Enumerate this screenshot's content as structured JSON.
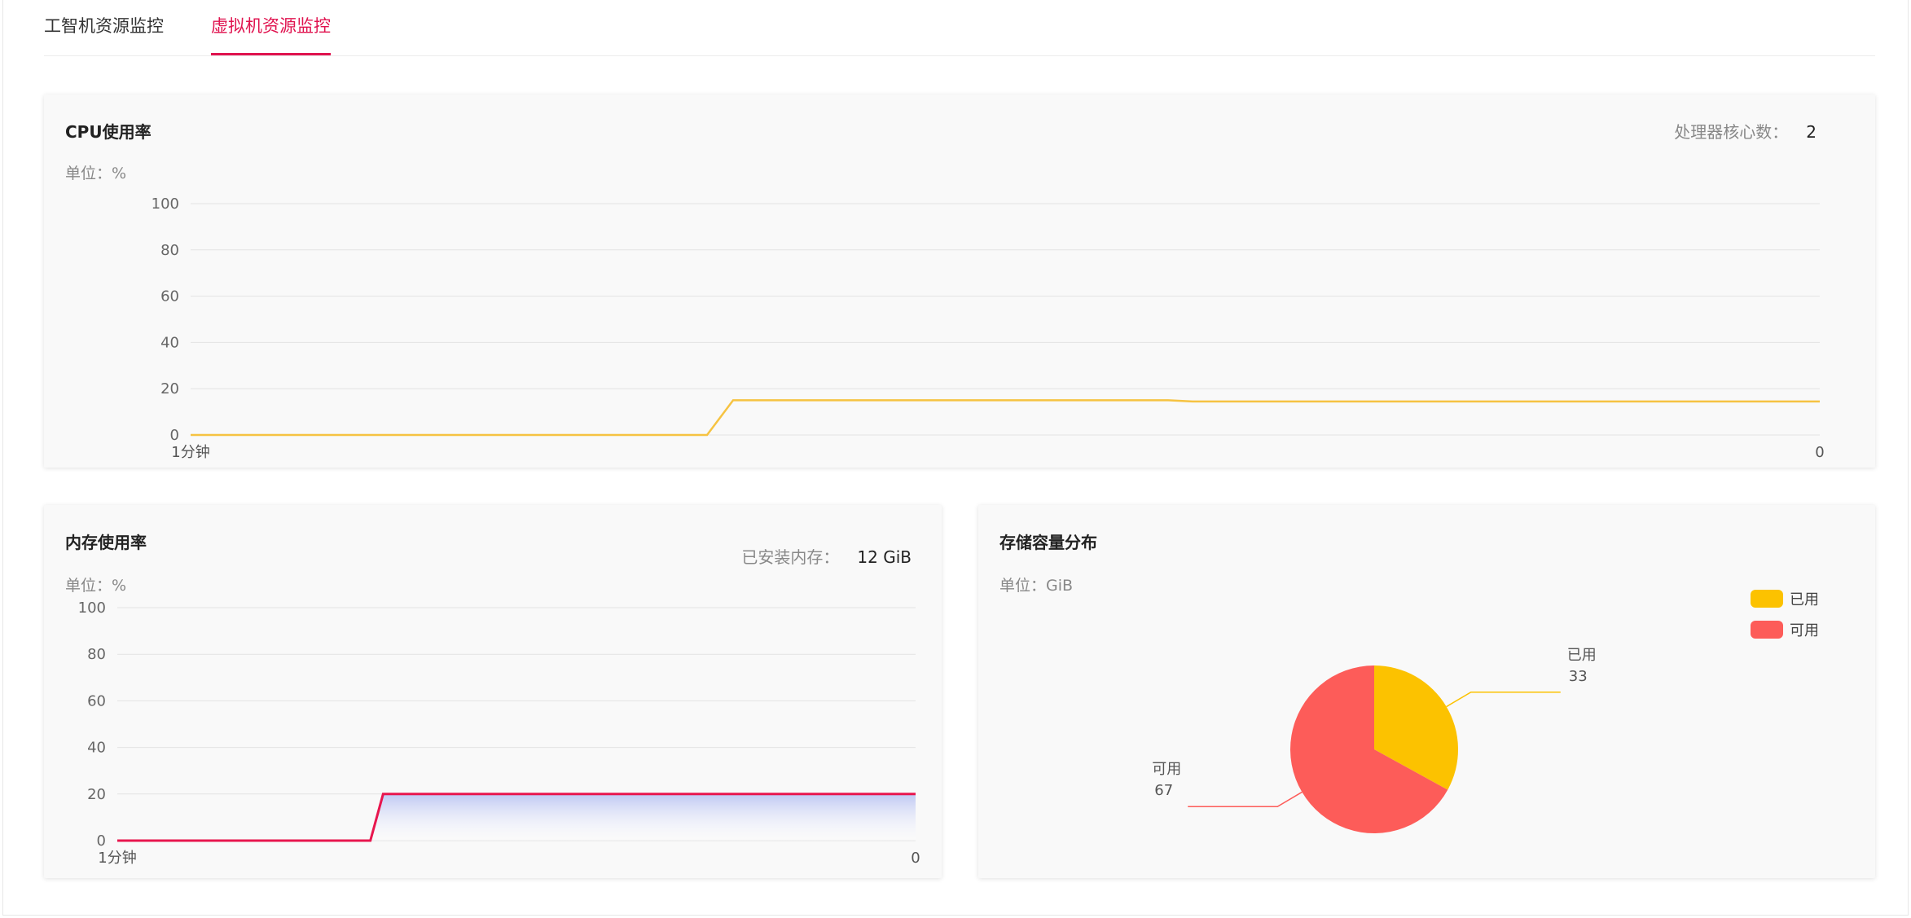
{
  "tabs": [
    {
      "label": "工智机资源监控",
      "active": false
    },
    {
      "label": "虚拟机资源监控",
      "active": true
    }
  ],
  "colors": {
    "accent": "#e0134f",
    "cpu_line": "#f6c342",
    "mem_line": "#e8164e",
    "used": "#fcc200",
    "available": "#fd5c59"
  },
  "cpu": {
    "title": "CPU使用率",
    "unit_label": "单位：%",
    "cores_label": "处理器核心数：",
    "cores_value": "2"
  },
  "memory": {
    "title": "内存使用率",
    "unit_label": "单位：%",
    "installed_label": "已安装内存：",
    "installed_value": "12 GiB"
  },
  "storage": {
    "title": "存储容量分布",
    "unit_label": "单位：GiB",
    "legend": [
      "已用",
      "可用"
    ]
  },
  "chart_data": [
    {
      "type": "line",
      "title": "CPU使用率",
      "ylim": [
        0,
        100
      ],
      "yticks": [
        "100",
        "80",
        "60",
        "40",
        "20",
        "0"
      ],
      "x_start_label": "1分钟",
      "x_end_label": "0",
      "grid": true,
      "series": [
        {
          "x": [
            0,
            0.317,
            0.333,
            0.6,
            0.615,
            1
          ],
          "values": [
            0,
            0,
            15,
            15,
            14.5,
            14.5
          ]
        }
      ]
    },
    {
      "type": "area",
      "title": "内存使用率",
      "ylim": [
        0,
        100
      ],
      "yticks": [
        "100",
        "80",
        "60",
        "40",
        "20",
        "0"
      ],
      "x_start_label": "1分钟",
      "x_end_label": "0",
      "grid": true,
      "series": [
        {
          "x": [
            0,
            0.317,
            0.333,
            1
          ],
          "values": [
            0,
            0,
            20,
            20
          ]
        }
      ]
    },
    {
      "type": "pie",
      "title": "存储容量分布",
      "legend_position": "top-right",
      "slices": [
        {
          "label": "已用",
          "value": 33
        },
        {
          "label": "可用",
          "value": 67
        }
      ]
    }
  ]
}
